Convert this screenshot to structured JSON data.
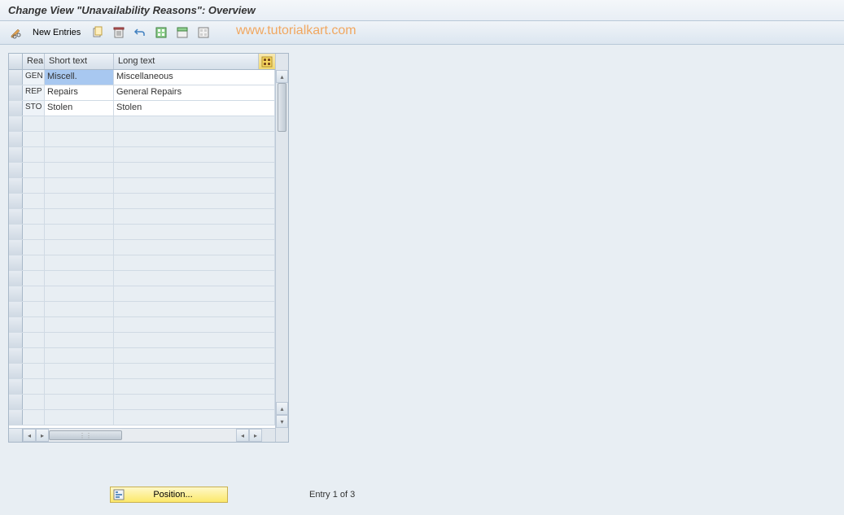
{
  "title": "Change View \"Unavailability Reasons\": Overview",
  "toolbar": {
    "new_entries": "New Entries"
  },
  "watermark": "www.tutorialkart.com",
  "table": {
    "headers": {
      "rea": "Rea",
      "short": "Short text",
      "long": "Long text"
    },
    "rows": [
      {
        "rea": "GEN",
        "short": "Miscell.",
        "long": "Miscellaneous",
        "selected": true
      },
      {
        "rea": "REP",
        "short": "Repairs",
        "long": "General Repairs",
        "selected": false
      },
      {
        "rea": "STO",
        "short": "Stolen",
        "long": "Stolen",
        "selected": false
      }
    ]
  },
  "footer": {
    "position_label": "Position...",
    "entry_status": "Entry 1 of 3"
  }
}
